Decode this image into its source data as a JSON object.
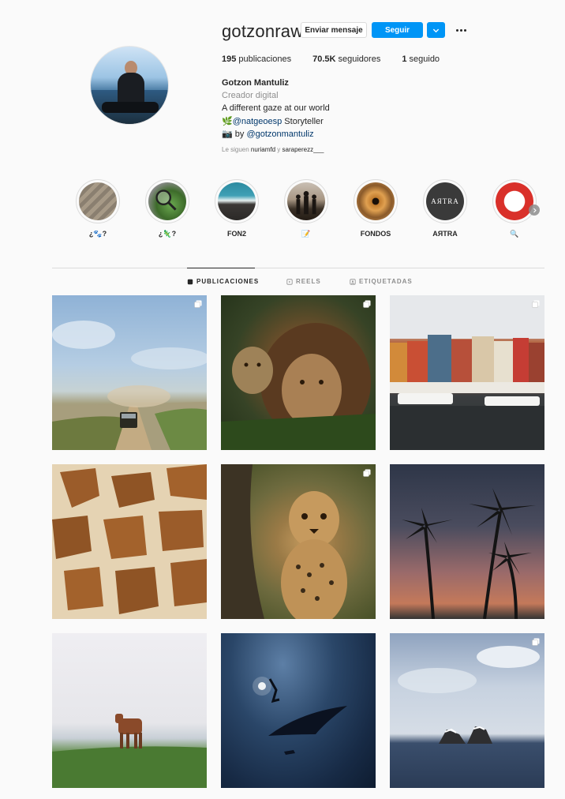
{
  "profile": {
    "username": "gotzonraw",
    "message_button": "Enviar mensaje",
    "follow_button": "Seguir",
    "posts_count": "195",
    "posts_label": "publicaciones",
    "followers_count": "70.5K",
    "followers_label": "seguidores",
    "following_count": "1",
    "following_label": "seguido",
    "full_name": "Gotzon Mantuliz",
    "category": "Creador digital",
    "bio_line1": "A different gaze at our world",
    "bio_line2_prefix": "🌿",
    "bio_line2_link": "@natgeoesp",
    "bio_line2_suffix": " Storyteller",
    "bio_line3_prefix": "📷 by ",
    "bio_line3_link": "@gotzonmantuliz",
    "followed_by_prefix": "Le siguen ",
    "followed_by_user1": "nuriamfd",
    "followed_by_joiner": " y ",
    "followed_by_user2": "saraperezz___"
  },
  "highlights": [
    {
      "label": "¿🐾?"
    },
    {
      "label": "¿🦎?"
    },
    {
      "label": "FON2"
    },
    {
      "label": "📝"
    },
    {
      "label": "FONDOS"
    },
    {
      "label": "AЯTRA",
      "inner_text": "AЯTRA"
    },
    {
      "label": "🔍"
    }
  ],
  "tabs": [
    {
      "label": "PUBLICACIONES",
      "active": true
    },
    {
      "label": "REELS",
      "active": false
    },
    {
      "label": "ETIQUETADAS",
      "active": false
    }
  ],
  "posts": [
    {
      "subject": "safari-jeep",
      "multi": true
    },
    {
      "subject": "lions",
      "multi": true
    },
    {
      "subject": "nyhavn-harbor",
      "multi": true
    },
    {
      "subject": "giraffe-pattern",
      "multi": false
    },
    {
      "subject": "cheetah-cub",
      "multi": true
    },
    {
      "subject": "palm-trees-sunset",
      "multi": false
    },
    {
      "subject": "cow-on-cliff",
      "multi": false
    },
    {
      "subject": "diver-and-manta",
      "multi": false
    },
    {
      "subject": "sea-rocks",
      "multi": true
    }
  ],
  "colors": {
    "accent": "#0095f6",
    "link": "#00376b",
    "muted": "#8e8e8e",
    "text": "#262626",
    "background": "#fafafa"
  }
}
